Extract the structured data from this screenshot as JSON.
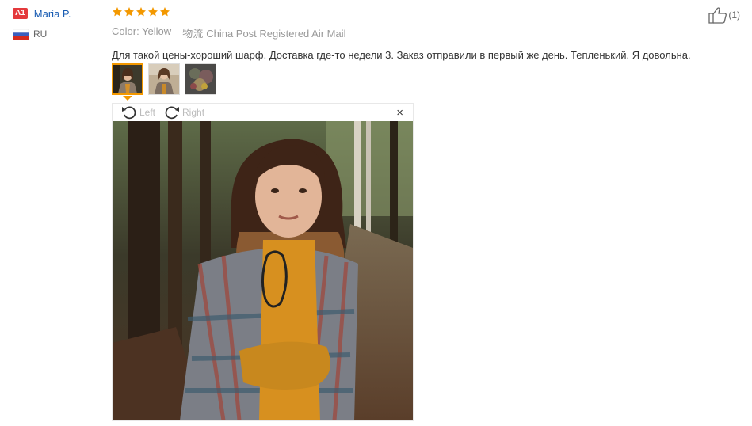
{
  "user": {
    "level": "A1",
    "name": "Maria P.",
    "country": "RU"
  },
  "review": {
    "rating": 5,
    "color_label": "Color:",
    "color_value": "Yellow",
    "shipping_icon": "物流",
    "shipping_value": "China Post Registered Air Mail",
    "text": "Для такой цены-хороший шарф. Доставка где-то недели 3. Заказ отправили в первый же день. Тепленький. Я довольна."
  },
  "viewer": {
    "rotate_left": "Left",
    "rotate_right": "Right",
    "close": "×"
  },
  "like": {
    "count": "(1)"
  },
  "colors": {
    "star": "#f39800",
    "name_link": "#1a5db3",
    "badge": "#e4393c",
    "thumb_active_border": "#f39800"
  },
  "icons": [
    "flag-ru-icon",
    "star-icon",
    "rotate-left-icon",
    "rotate-right-icon",
    "close-icon",
    "thumbs-up-icon"
  ]
}
